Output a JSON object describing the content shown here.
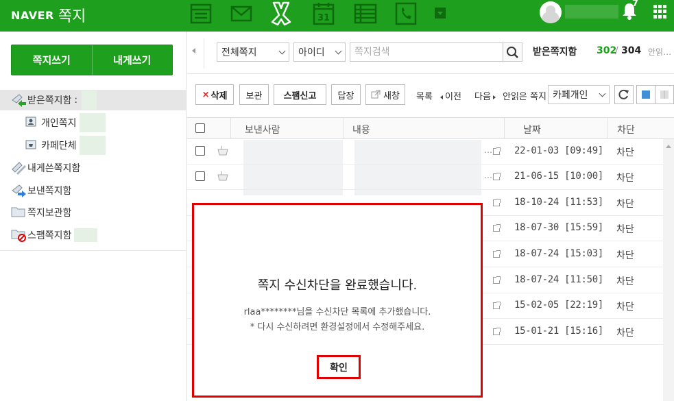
{
  "app": {
    "brand": "NAVER",
    "service": "쪽지"
  },
  "top_nav": {
    "icons": [
      "mail-list-icon",
      "mail-icon",
      "note-icon",
      "calendar-icon",
      "list-icon",
      "phone-icon",
      "more-icon"
    ],
    "calendar_day": "31",
    "notification_count": "7"
  },
  "sidebar": {
    "write_button": "쪽지쓰기",
    "write_self_button": "내게쓰기",
    "folders": [
      {
        "label": "받은쪽지함",
        "suffix": ":"
      },
      {
        "label": "개인쪽지"
      },
      {
        "label": "카페단체"
      },
      {
        "label": "내게쓴쪽지함"
      },
      {
        "label": "보낸쪽지함"
      },
      {
        "label": "쪽지보관함"
      },
      {
        "label": "스팸쪽지함"
      }
    ]
  },
  "search": {
    "filter_value": "전체쪽지",
    "field_value": "아이디",
    "placeholder": "쪽지검색"
  },
  "inbox": {
    "title": "받은쪽지함",
    "unread": "302",
    "separator": "/",
    "total": "304",
    "unread_label": "안읽…"
  },
  "toolbar": {
    "delete": "삭제",
    "archive": "보관",
    "spam": "스팸신고",
    "reply": "답장",
    "new_window": "새창",
    "list_label": "목록",
    "prev": "이전",
    "next": "다음",
    "unread_only": "안읽은 쪽지",
    "cafe_filter": "카페개인"
  },
  "table": {
    "headers": {
      "sender": "보낸사람",
      "content": "내용",
      "date": "날짜",
      "block": "차단"
    },
    "rows": [
      {
        "date": "22-01-03 [09:49]",
        "block": "차단"
      },
      {
        "date": "21-06-15 [10:00]",
        "block": "차단"
      },
      {
        "date": "18-10-24 [11:53]",
        "block": "차단"
      },
      {
        "date": "18-07-30 [15:59]",
        "block": "차단"
      },
      {
        "date": "18-07-24 [15:03]",
        "block": "차단"
      },
      {
        "date": "18-07-24 [11:50]",
        "block": "차단"
      },
      {
        "date": "15-02-05 [22:19]",
        "block": "차단"
      },
      {
        "date": "15-01-21 [15:16]",
        "block": "차단"
      }
    ]
  },
  "modal": {
    "title": "쪽지 수신차단을 완료했습니다.",
    "message_line1": "rlaa********님을 수신차단 목록에 추가했습니다.",
    "message_line2": "* 다시 수신하려면 환경설정에서 수정해주세요.",
    "confirm": "확인"
  },
  "colors": {
    "brand_green": "#1ea01e",
    "highlight_red": "#e00000"
  }
}
